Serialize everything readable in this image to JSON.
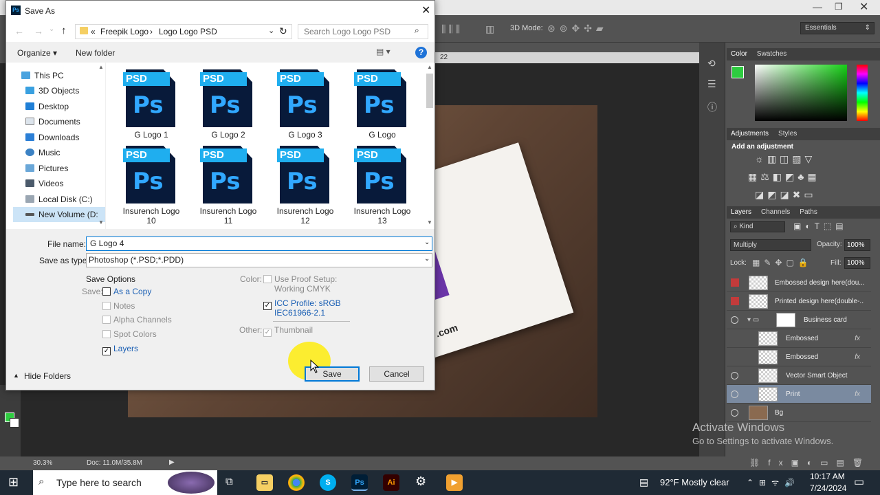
{
  "photoshop": {
    "tool_mode": "3D Mode:",
    "workspace": "Essentials",
    "zoom": "30.3%",
    "doc_size": "Doc: 11.0M/35.8M",
    "ruler_mark": "22",
    "color_tabs": [
      "Color",
      "Swatches"
    ],
    "adjust_tabs": [
      "Adjustments",
      "Styles"
    ],
    "add_adjustment": "Add an adjustment",
    "layer_tabs": [
      "Layers",
      "Channels",
      "Paths"
    ],
    "kind_label": "Kind",
    "blend_mode": "Multiply",
    "opacity_label": "Opacity:",
    "opacity_value": "100%",
    "lock_label": "Lock:",
    "fill_label": "Fill:",
    "fill_value": "100%",
    "layers": [
      {
        "name": "Embossed design here(dou...",
        "fx": ""
      },
      {
        "name": "Printed design here(double-...",
        "fx": ""
      },
      {
        "name": "Business card",
        "fx": ""
      },
      {
        "name": "Embossed",
        "fx": "fx"
      },
      {
        "name": "Embossed",
        "fx": "fx"
      },
      {
        "name": "Vector Smart Object",
        "fx": ""
      },
      {
        "name": "Print",
        "fx": "fx"
      },
      {
        "name": "Bg",
        "fx": ""
      }
    ],
    "card_text": ".com",
    "activate_title": "Activate Windows",
    "activate_sub": "Go to Settings to activate Windows."
  },
  "dialog": {
    "title": "Save As",
    "path_prefix": "«",
    "path_parts": [
      "Freepik Logo",
      "Logo Logo  PSD"
    ],
    "search_placeholder": "Search Logo Logo  PSD",
    "organize": "Organize ▾",
    "new_folder": "New folder",
    "sidebar": [
      "This PC",
      "3D Objects",
      "Desktop",
      "Documents",
      "Downloads",
      "Music",
      "Pictures",
      "Videos",
      "Local Disk (C:)",
      "New Volume (D:"
    ],
    "psd_band": "PSD",
    "psd_glyph": "Ps",
    "files": [
      "G  Logo 1",
      "G  Logo 2",
      "G  Logo 3",
      "G  Logo",
      "Insurench Logo 10",
      "Insurench Logo 11",
      "Insurench Logo 12",
      "Insurench Logo 13"
    ],
    "file_name_label": "File name:",
    "file_name_value": "G  Logo 4",
    "save_type_label": "Save as type:",
    "save_type_value": "Photoshop (*.PSD;*.PDD)",
    "save_options": "Save Options",
    "save_label": "Save:",
    "opts": {
      "as_copy": "As a Copy",
      "notes": "Notes",
      "alpha": "Alpha Channels",
      "spot": "Spot Colors",
      "layers": "Layers"
    },
    "color_label": "Color:",
    "proof_setup": "Use Proof Setup:",
    "proof_value": "Working CMYK",
    "icc_label": "ICC Profile:  sRGB",
    "icc_value": "IEC61966-2.1",
    "other_label": "Other:",
    "thumbnail": "Thumbnail",
    "hide_folders": "Hide Folders",
    "save_btn": "Save",
    "cancel_btn": "Cancel"
  },
  "taskbar": {
    "search_placeholder": "Type here to search",
    "weather": "92°F  Mostly clear",
    "time": "10:17 AM",
    "date": "7/24/2024"
  }
}
